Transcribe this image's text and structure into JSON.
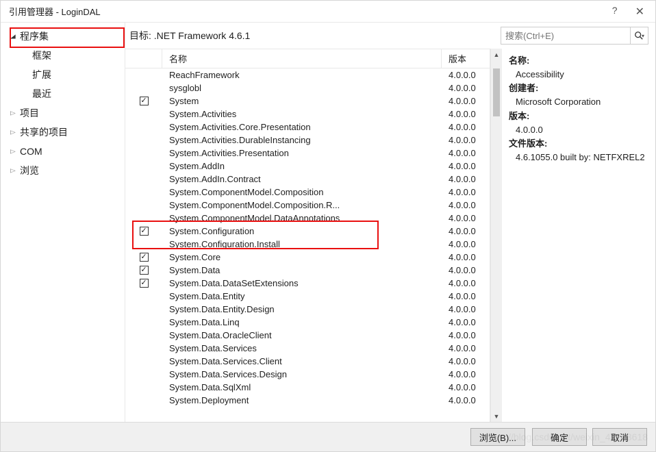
{
  "window": {
    "title": "引用管理器 - LoginDAL",
    "helpIcon": "?",
    "closeIcon": "✕"
  },
  "sidebar": {
    "items": [
      {
        "label": "程序集",
        "expanded": true,
        "children": [
          {
            "label": "框架"
          },
          {
            "label": "扩展"
          },
          {
            "label": "最近"
          }
        ]
      },
      {
        "label": "项目",
        "expanded": false
      },
      {
        "label": "共享的项目",
        "expanded": false
      },
      {
        "label": "COM",
        "expanded": false
      },
      {
        "label": "浏览",
        "expanded": false
      }
    ]
  },
  "toolbar": {
    "target": "目标: .NET Framework 4.6.1",
    "searchPlaceholder": "搜索(Ctrl+E)"
  },
  "columns": {
    "name": "名称",
    "version": "版本"
  },
  "assemblies": [
    {
      "name": "ReachFramework",
      "version": "4.0.0.0",
      "checked": false
    },
    {
      "name": "sysglobl",
      "version": "4.0.0.0",
      "checked": false
    },
    {
      "name": "System",
      "version": "4.0.0.0",
      "checked": true
    },
    {
      "name": "System.Activities",
      "version": "4.0.0.0",
      "checked": false
    },
    {
      "name": "System.Activities.Core.Presentation",
      "version": "4.0.0.0",
      "checked": false
    },
    {
      "name": "System.Activities.DurableInstancing",
      "version": "4.0.0.0",
      "checked": false
    },
    {
      "name": "System.Activities.Presentation",
      "version": "4.0.0.0",
      "checked": false
    },
    {
      "name": "System.AddIn",
      "version": "4.0.0.0",
      "checked": false
    },
    {
      "name": "System.AddIn.Contract",
      "version": "4.0.0.0",
      "checked": false
    },
    {
      "name": "System.ComponentModel.Composition",
      "version": "4.0.0.0",
      "checked": false
    },
    {
      "name": "System.ComponentModel.Composition.R...",
      "version": "4.0.0.0",
      "checked": false
    },
    {
      "name": "System.ComponentModel.DataAnnotations",
      "version": "4.0.0.0",
      "checked": false
    },
    {
      "name": "System.Configuration",
      "version": "4.0.0.0",
      "checked": true,
      "highlight": true
    },
    {
      "name": "System.Configuration.Install",
      "version": "4.0.0.0",
      "checked": false
    },
    {
      "name": "System.Core",
      "version": "4.0.0.0",
      "checked": true
    },
    {
      "name": "System.Data",
      "version": "4.0.0.0",
      "checked": true
    },
    {
      "name": "System.Data.DataSetExtensions",
      "version": "4.0.0.0",
      "checked": true
    },
    {
      "name": "System.Data.Entity",
      "version": "4.0.0.0",
      "checked": false
    },
    {
      "name": "System.Data.Entity.Design",
      "version": "4.0.0.0",
      "checked": false
    },
    {
      "name": "System.Data.Linq",
      "version": "4.0.0.0",
      "checked": false
    },
    {
      "name": "System.Data.OracleClient",
      "version": "4.0.0.0",
      "checked": false
    },
    {
      "name": "System.Data.Services",
      "version": "4.0.0.0",
      "checked": false
    },
    {
      "name": "System.Data.Services.Client",
      "version": "4.0.0.0",
      "checked": false
    },
    {
      "name": "System.Data.Services.Design",
      "version": "4.0.0.0",
      "checked": false
    },
    {
      "name": "System.Data.SqlXml",
      "version": "4.0.0.0",
      "checked": false
    },
    {
      "name": "System.Deployment",
      "version": "4.0.0.0",
      "checked": false
    }
  ],
  "details": {
    "nameLabel": "名称:",
    "name": "Accessibility",
    "creatorLabel": "创建者:",
    "creator": "Microsoft Corporation",
    "versionLabel": "版本:",
    "version": "4.0.0.0",
    "fileVersionLabel": "文件版本:",
    "fileVersion": "4.6.1055.0 built by: NETFXREL2"
  },
  "footer": {
    "browse": "浏览(B)...",
    "ok": "确定",
    "cancel": "取消"
  }
}
